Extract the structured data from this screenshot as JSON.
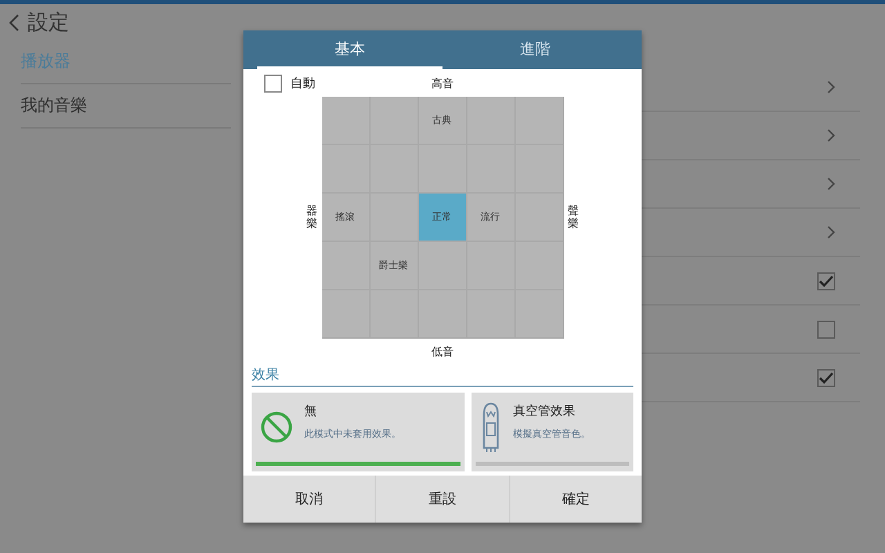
{
  "header": {
    "title": "設定"
  },
  "sidebar": {
    "items": [
      {
        "label": "播放器",
        "selected": true
      },
      {
        "label": "我的音樂",
        "selected": false
      }
    ]
  },
  "settings_rows": [
    {
      "kind": "link"
    },
    {
      "kind": "link"
    },
    {
      "kind": "link"
    },
    {
      "kind": "link"
    },
    {
      "kind": "check",
      "checked": true
    },
    {
      "kind": "check",
      "checked": false
    },
    {
      "kind": "check",
      "checked": true
    }
  ],
  "dialog": {
    "tabs": [
      {
        "label": "基本",
        "selected": true
      },
      {
        "label": "進階",
        "selected": false
      }
    ],
    "auto": {
      "label": "自動",
      "checked": false
    },
    "axis": {
      "top": "高音",
      "bottom": "低音",
      "left": "器樂",
      "right": "聲樂"
    },
    "grid": [
      [
        {
          "selected": false
        },
        {
          "selected": false
        },
        {
          "label": "古典",
          "selected": false
        },
        {
          "selected": false
        },
        {
          "selected": false
        }
      ],
      [
        {
          "selected": false
        },
        {
          "selected": false
        },
        {
          "selected": false
        },
        {
          "selected": false
        },
        {
          "selected": false
        }
      ],
      [
        {
          "label": "搖滾",
          "selected": false
        },
        {
          "selected": false
        },
        {
          "label": "正常",
          "selected": true
        },
        {
          "label": "流行",
          "selected": false
        },
        {
          "selected": false
        }
      ],
      [
        {
          "selected": false
        },
        {
          "label": "爵士樂",
          "selected": false
        },
        {
          "selected": false
        },
        {
          "selected": false
        },
        {
          "selected": false
        }
      ],
      [
        {
          "selected": false
        },
        {
          "selected": false
        },
        {
          "selected": false
        },
        {
          "selected": false
        },
        {
          "selected": false
        }
      ]
    ],
    "effects_title": "效果",
    "effects": [
      {
        "kind": "none",
        "title": "無",
        "description": "此模式中未套用效果。",
        "selected": true
      },
      {
        "kind": "tube",
        "title": "真空管效果",
        "description": "模擬真空管音色。",
        "selected": false
      }
    ],
    "buttons": [
      "取消",
      "重設",
      "確定"
    ]
  }
}
